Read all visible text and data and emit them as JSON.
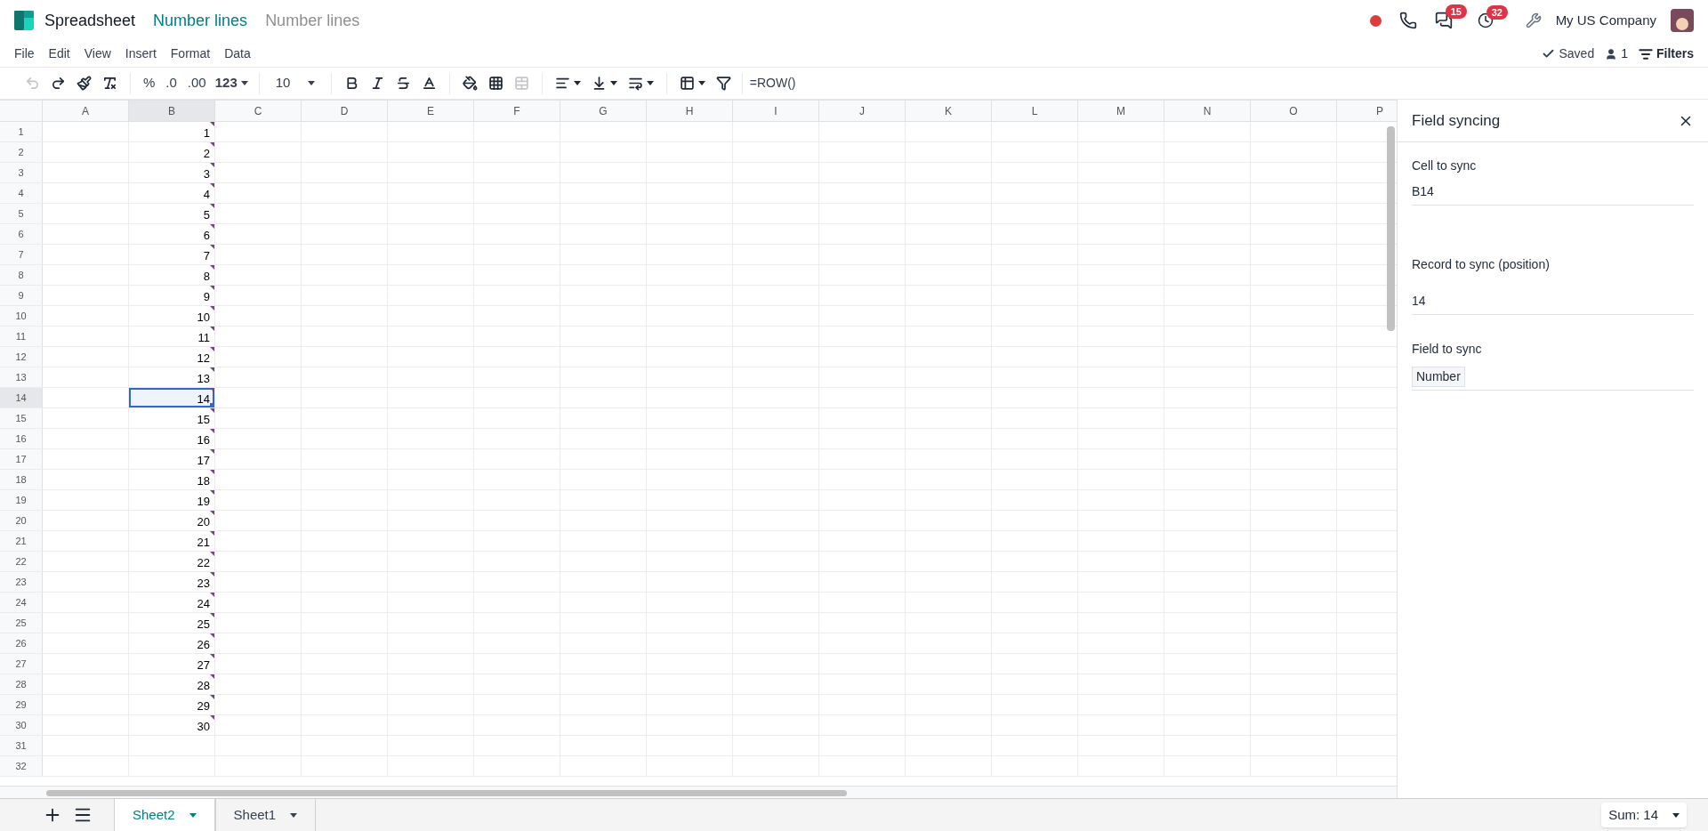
{
  "app": {
    "name": "Spreadsheet"
  },
  "breadcrumbs": [
    {
      "label": "Number lines",
      "kind": "link"
    },
    {
      "label": "Number lines",
      "kind": "current"
    }
  ],
  "systray": {
    "recording": true,
    "messages_badge": "15",
    "activities_badge": "32",
    "company": "My US Company"
  },
  "menu": [
    "File",
    "Edit",
    "View",
    "Insert",
    "Format",
    "Data"
  ],
  "status": {
    "saved": "Saved",
    "users": "1",
    "filters": "Filters"
  },
  "toolbar": [
    {
      "kind": "icon",
      "disabled": true
    },
    {
      "kind": "icon",
      "disabled": false
    },
    {
      "kind": "icon",
      "disabled": false
    },
    {
      "kind": "icon",
      "disabled": false
    },
    {
      "kind": "sep"
    },
    {
      "kind": "text",
      "label": "%"
    },
    {
      "kind": "text",
      "label": ".0"
    },
    {
      "kind": "text",
      "label": ".00"
    },
    {
      "kind": "dropdown",
      "label": "123"
    },
    {
      "kind": "sep"
    },
    {
      "kind": "select",
      "label": "10"
    },
    {
      "kind": "sep"
    },
    {
      "kind": "icon",
      "disabled": false
    },
    {
      "kind": "icon",
      "disabled": false
    },
    {
      "kind": "icon",
      "disabled": false
    },
    {
      "kind": "icon",
      "disabled": false
    },
    {
      "kind": "sep"
    },
    {
      "kind": "icon",
      "disabled": false
    },
    {
      "kind": "icon",
      "disabled": false
    },
    {
      "kind": "icon",
      "disabled": true
    },
    {
      "kind": "sep"
    },
    {
      "kind": "icondrop",
      "disabled": false
    },
    {
      "kind": "icondrop",
      "disabled": false
    },
    {
      "kind": "icondrop",
      "disabled": false
    },
    {
      "kind": "sep"
    },
    {
      "kind": "icondrop",
      "disabled": false
    },
    {
      "kind": "icon",
      "disabled": false
    }
  ],
  "formula": "=ROW()",
  "columns": [
    {
      "label": "A",
      "selected": false
    },
    {
      "label": "B",
      "selected": true
    },
    {
      "label": "C",
      "selected": false
    },
    {
      "label": "D",
      "selected": false
    },
    {
      "label": "E",
      "selected": false
    },
    {
      "label": "F",
      "selected": false
    },
    {
      "label": "G",
      "selected": false
    },
    {
      "label": "H",
      "selected": false
    },
    {
      "label": "I",
      "selected": false
    },
    {
      "label": "J",
      "selected": false
    },
    {
      "label": "K",
      "selected": false
    },
    {
      "label": "L",
      "selected": false
    },
    {
      "label": "M",
      "selected": false
    },
    {
      "label": "N",
      "selected": false
    },
    {
      "label": "O",
      "selected": false
    },
    {
      "label": "P",
      "selected": false
    }
  ],
  "rows": [
    {
      "header": "1",
      "value": "1",
      "flag": true,
      "selected": false
    },
    {
      "header": "2",
      "value": "2",
      "flag": true,
      "selected": false
    },
    {
      "header": "3",
      "value": "3",
      "flag": true,
      "selected": false
    },
    {
      "header": "4",
      "value": "4",
      "flag": true,
      "selected": false
    },
    {
      "header": "5",
      "value": "5",
      "flag": true,
      "selected": false
    },
    {
      "header": "6",
      "value": "6",
      "flag": true,
      "selected": false
    },
    {
      "header": "7",
      "value": "7",
      "flag": true,
      "selected": false
    },
    {
      "header": "8",
      "value": "8",
      "flag": true,
      "selected": false
    },
    {
      "header": "9",
      "value": "9",
      "flag": true,
      "selected": false
    },
    {
      "header": "10",
      "value": "10",
      "flag": true,
      "selected": false
    },
    {
      "header": "11",
      "value": "11",
      "flag": true,
      "selected": false
    },
    {
      "header": "12",
      "value": "12",
      "flag": true,
      "selected": false
    },
    {
      "header": "13",
      "value": "13",
      "flag": true,
      "selected": false
    },
    {
      "header": "14",
      "value": "14",
      "flag": true,
      "selected": true
    },
    {
      "header": "15",
      "value": "15",
      "flag": true,
      "selected": false
    },
    {
      "header": "16",
      "value": "16",
      "flag": true,
      "selected": false
    },
    {
      "header": "17",
      "value": "17",
      "flag": true,
      "selected": false
    },
    {
      "header": "18",
      "value": "18",
      "flag": true,
      "selected": false
    },
    {
      "header": "19",
      "value": "19",
      "flag": true,
      "selected": false
    },
    {
      "header": "20",
      "value": "20",
      "flag": true,
      "selected": false
    },
    {
      "header": "21",
      "value": "21",
      "flag": true,
      "selected": false
    },
    {
      "header": "22",
      "value": "22",
      "flag": true,
      "selected": false
    },
    {
      "header": "23",
      "value": "23",
      "flag": true,
      "selected": false
    },
    {
      "header": "24",
      "value": "24",
      "flag": true,
      "selected": false
    },
    {
      "header": "25",
      "value": "25",
      "flag": true,
      "selected": false
    },
    {
      "header": "26",
      "value": "26",
      "flag": true,
      "selected": false
    },
    {
      "header": "27",
      "value": "27",
      "flag": true,
      "selected": false
    },
    {
      "header": "28",
      "value": "28",
      "flag": true,
      "selected": false
    },
    {
      "header": "29",
      "value": "29",
      "flag": true,
      "selected": false
    },
    {
      "header": "30",
      "value": "30",
      "flag": true,
      "selected": false
    },
    {
      "header": "31",
      "flag": false,
      "selected": false
    },
    {
      "header": "32",
      "flag": false,
      "selected": false
    }
  ],
  "panel": {
    "title": "Field syncing",
    "fields": [
      {
        "label": "Cell to sync",
        "value": "B14",
        "kind": "text"
      },
      {
        "label": "Record to sync (position)",
        "value": "14",
        "kind": "text"
      },
      {
        "label": "Field to sync",
        "value": "Number",
        "kind": "tag"
      }
    ]
  },
  "sheets": [
    {
      "label": "Sheet2",
      "selected": true
    },
    {
      "label": "Sheet1",
      "selected": false
    }
  ],
  "sum": "Sum: 14"
}
